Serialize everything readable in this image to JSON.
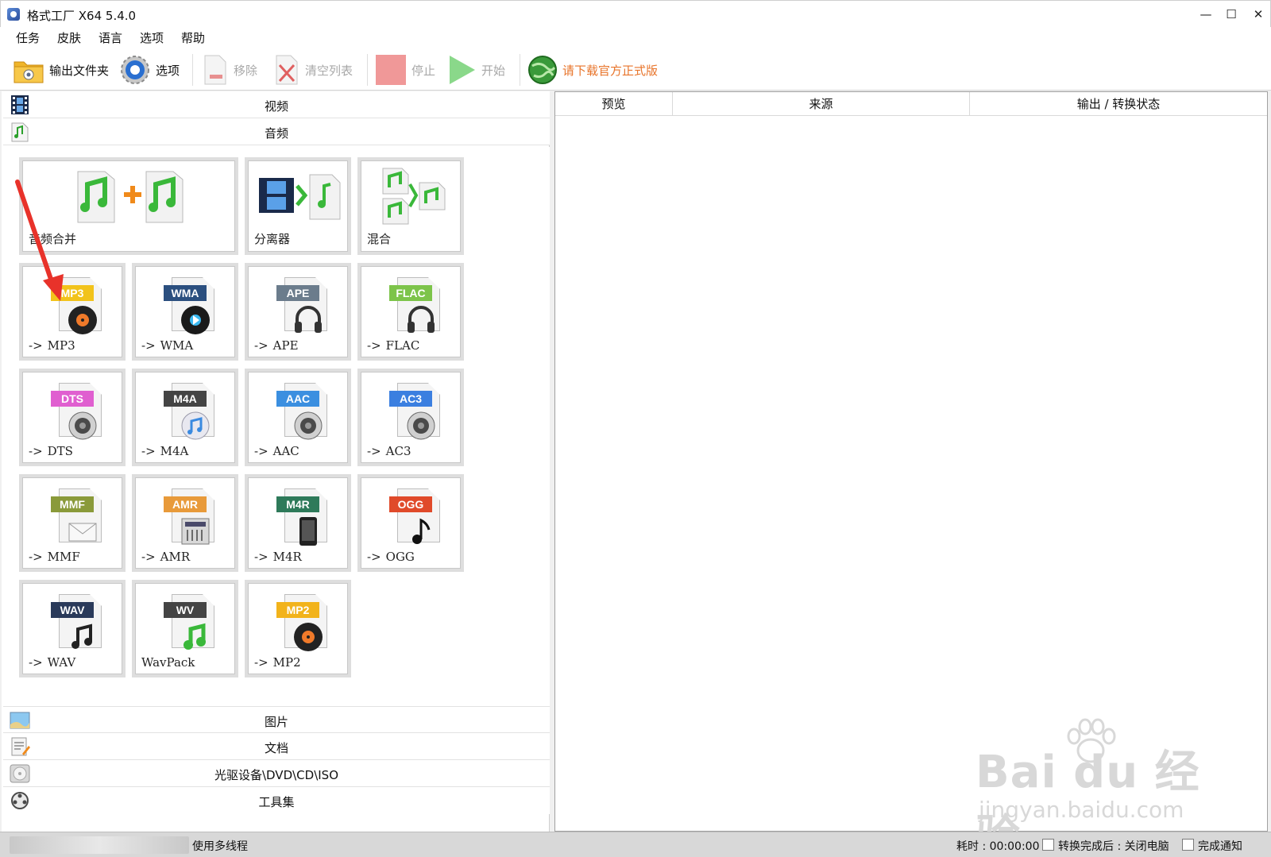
{
  "window": {
    "title": "格式工厂 X64 5.4.0",
    "minimize": "—",
    "maximize": "☐",
    "close": "✕"
  },
  "menu": [
    "任务",
    "皮肤",
    "语言",
    "选项",
    "帮助"
  ],
  "toolbar": {
    "output_folder": "输出文件夹",
    "options": "选项",
    "remove": "移除",
    "clear_list": "清空列表",
    "stop": "停止",
    "start": "开始",
    "download": "请下载官方正式版",
    "download_color": "#e8742a"
  },
  "categories": {
    "video": "视频",
    "audio": "音频",
    "image": "图片",
    "document": "文档",
    "disc": "光驱设备\\DVD\\CD\\ISO",
    "tools": "工具集"
  },
  "audio_tools": {
    "merge": "音频合并",
    "splitter": "分离器",
    "mix": "混合"
  },
  "formats": [
    {
      "badge": "MP3",
      "label": "MP3",
      "color": "#f2c31b",
      "glyph": "disc-icon",
      "arrow": "->"
    },
    {
      "badge": "WMA",
      "label": "WMA",
      "color": "#2b4f7f",
      "glyph": "play-disc-icon",
      "arrow": "->"
    },
    {
      "badge": "APE",
      "label": "APE",
      "color": "#6b7c8c",
      "glyph": "headphones-icon",
      "arrow": "->"
    },
    {
      "badge": "FLAC",
      "label": "FLAC",
      "color": "#7dc44a",
      "glyph": "headphones-icon",
      "arrow": "->"
    },
    {
      "badge": "DTS",
      "label": "DTS",
      "color": "#e05fd0",
      "glyph": "speaker-icon",
      "arrow": "->"
    },
    {
      "badge": "M4A",
      "label": "M4A",
      "color": "#444444",
      "glyph": "itunes-icon",
      "arrow": "->"
    },
    {
      "badge": "AAC",
      "label": "AAC",
      "color": "#3b8fe0",
      "glyph": "speaker-icon",
      "arrow": "->"
    },
    {
      "badge": "AC3",
      "label": "AC3",
      "color": "#3b7fe0",
      "glyph": "speaker-icon",
      "arrow": "->"
    },
    {
      "badge": "MMF",
      "label": "MMF",
      "color": "#8a9a3a",
      "glyph": "envelope-icon",
      "arrow": "->"
    },
    {
      "badge": "AMR",
      "label": "AMR",
      "color": "#e89a3a",
      "glyph": "mixer-icon",
      "arrow": "->"
    },
    {
      "badge": "M4R",
      "label": "M4R",
      "color": "#2e7a5a",
      "glyph": "phone-icon",
      "arrow": "->"
    },
    {
      "badge": "OGG",
      "label": "OGG",
      "color": "#e04a2a",
      "glyph": "note-icon",
      "arrow": "->"
    },
    {
      "badge": "WAV",
      "label": "WAV",
      "color": "#2a3a5a",
      "glyph": "notes-icon",
      "arrow": "->"
    },
    {
      "badge": "WV",
      "label": "WavPack",
      "color": "#444444",
      "glyph": "green-note-icon",
      "arrow": ""
    },
    {
      "badge": "MP2",
      "label": "MP2",
      "color": "#f2b31b",
      "glyph": "disc-icon",
      "arrow": "->"
    }
  ],
  "table": {
    "columns": [
      "预览",
      "来源",
      "输出 / 转换状态"
    ]
  },
  "watermark": {
    "main": "Bai du 经验",
    "sub": "jingyan.baidu.com"
  },
  "status": {
    "multithread": "使用多线程",
    "elapsed": "耗时 : 00:00:00",
    "after_convert": "转换完成后 : 关闭电脑",
    "notify": "完成通知"
  }
}
